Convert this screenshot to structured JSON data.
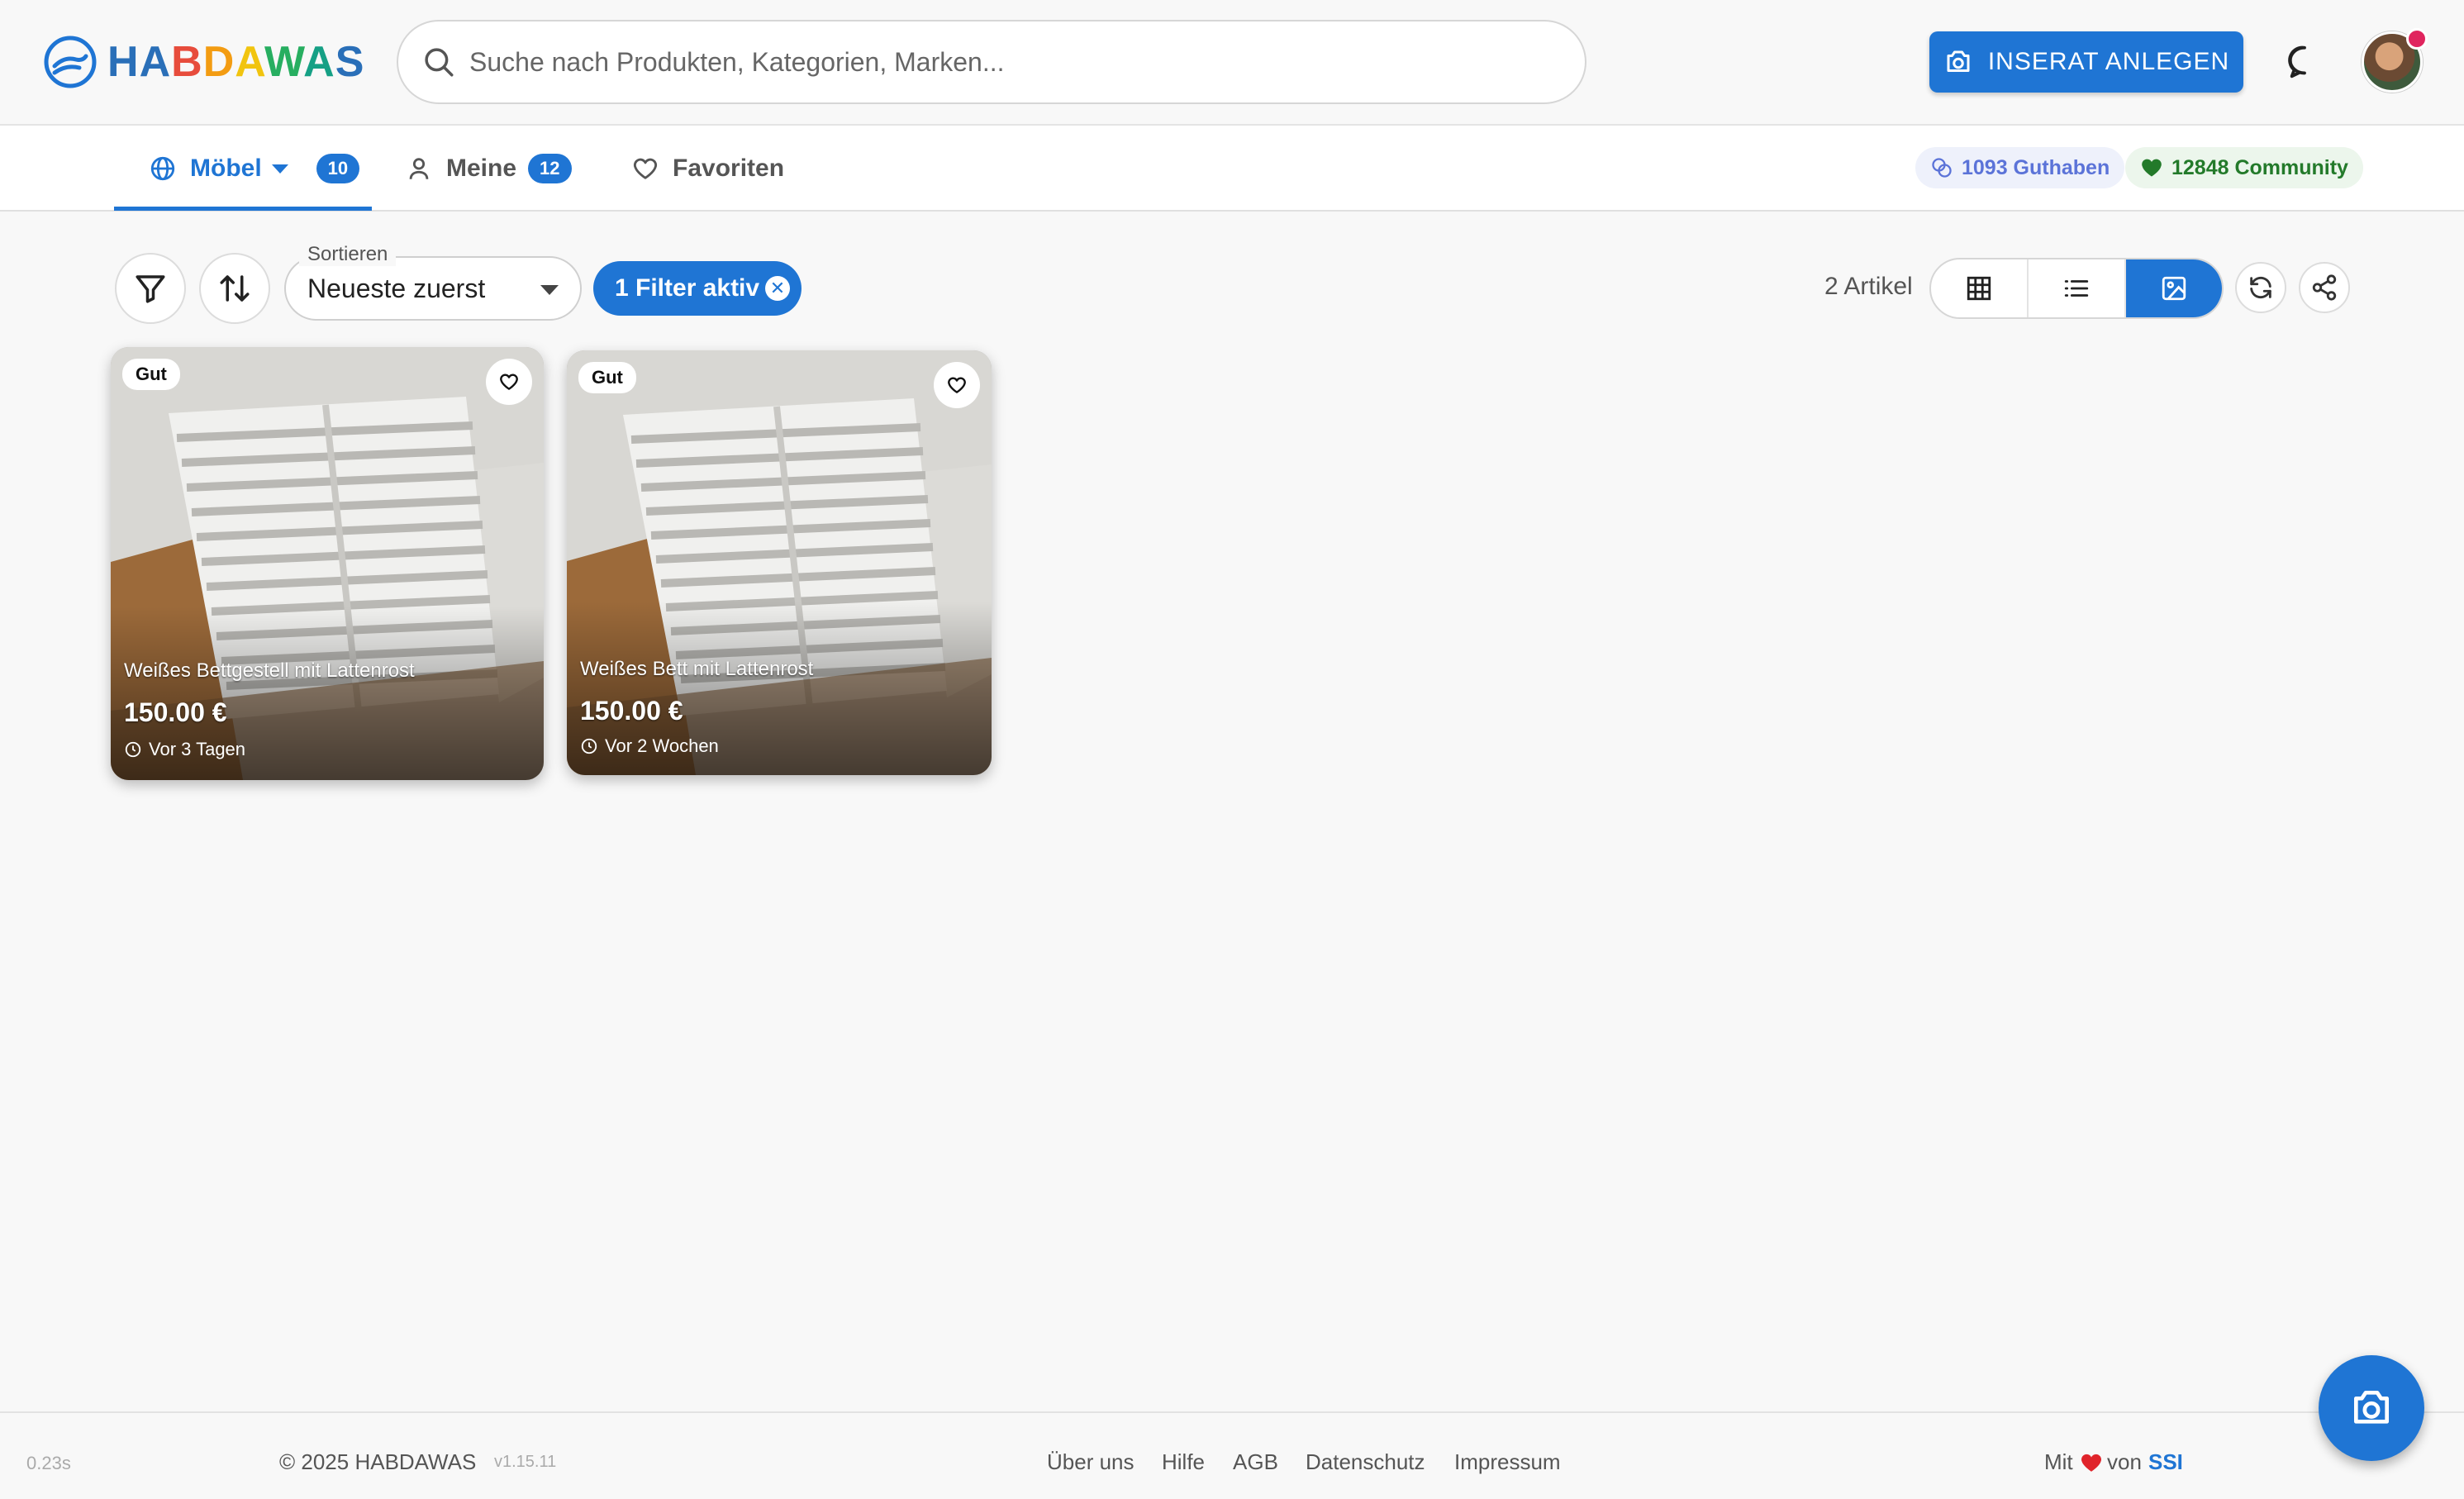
{
  "header": {
    "logo_text": "HABDAWAS",
    "search_placeholder": "Suche nach Produkten, Kategorien, Marken...",
    "cta_label": "INSERAT ANLEGEN"
  },
  "tabs": [
    {
      "label": "Möbel",
      "count": "10",
      "active": true
    },
    {
      "label": "Meine",
      "count": "12"
    },
    {
      "label": "Favoriten"
    }
  ],
  "stats": {
    "guthaben": "1093 Guthaben",
    "community": "12848 Community"
  },
  "toolbar": {
    "sort_label": "Sortieren",
    "sort_value": "Neueste zuerst",
    "filter_chip": "1 Filter aktiv",
    "article_count": "2 Artikel"
  },
  "cards": [
    {
      "condition": "Gut",
      "title": "Weißes Bettgestell mit Lattenrost",
      "price": "150.00 €",
      "time": "Vor 3 Tagen"
    },
    {
      "condition": "Gut",
      "title": "Weißes Bett mit Lattenrost",
      "price": "150.00 €",
      "time": "Vor 2 Wochen"
    }
  ],
  "footer": {
    "timing": "0.23s",
    "copyright": "© 2025 HABDAWAS",
    "version": "v1.15.11",
    "links": [
      "Über uns",
      "Hilfe",
      "AGB",
      "Datenschutz",
      "Impressum"
    ],
    "made_with_prefix": "Mit",
    "made_with_suffix": "von",
    "made_by": "SSI"
  },
  "colors": {
    "accent": "#1f75d4",
    "guthaben": "#5b73d8",
    "community": "#237a2a",
    "heart": "#e0242b"
  }
}
